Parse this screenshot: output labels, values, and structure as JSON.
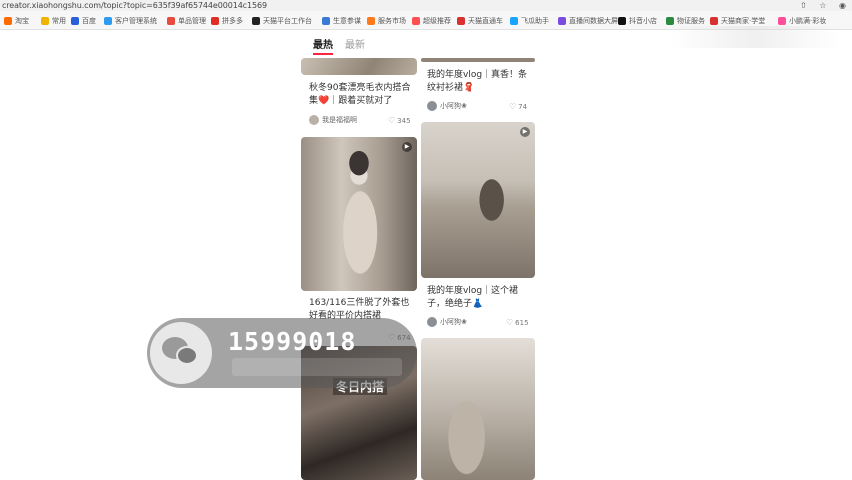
{
  "browser": {
    "url": "creator.xiaohongshu.com/topic?topic=635f39af65744e00014c1569",
    "bookmarks": [
      {
        "label": "淘宝",
        "color": "#ff6a00"
      },
      {
        "label": "常用",
        "color": "#f0b400"
      },
      {
        "label": "百度",
        "color": "#2b5fd9"
      },
      {
        "label": "客户管理系统",
        "color": "#2e9bf0"
      },
      {
        "label": "单品管理",
        "color": "#e84a3c"
      },
      {
        "label": "拼多多",
        "color": "#e02e24"
      },
      {
        "label": "天猫平台工作台",
        "color": "#222222"
      },
      {
        "label": "生意参谋",
        "color": "#3a7bd5"
      },
      {
        "label": "服务市场",
        "color": "#ff7a1a"
      },
      {
        "label": "超级推荐",
        "color": "#ff4f4f"
      },
      {
        "label": "天猫直通车",
        "color": "#d93030"
      },
      {
        "label": "飞瓜助手",
        "color": "#1aa3ff"
      },
      {
        "label": "直播间数据大屏",
        "color": "#7b4ce0"
      },
      {
        "label": "抖音小店",
        "color": "#111111"
      },
      {
        "label": "物证服务",
        "color": "#2b8a3e"
      },
      {
        "label": "天猫商家·学堂",
        "color": "#d93030"
      },
      {
        "label": "小鹏满·彩妆",
        "color": "#ff4f9a"
      }
    ]
  },
  "tabs": {
    "hot": "最热",
    "new": "最新"
  },
  "feed": {
    "left": [
      {
        "title": "秋冬90套漂亮毛衣内搭合集❤️｜跟着买就对了",
        "author": "我是福福啊",
        "likes": "345"
      },
      {
        "title": "163/116三件脱了外套也好看的平价内搭裙",
        "author": "",
        "likes": "674"
      },
      {
        "title": "冬日内搭",
        "author": "",
        "likes": ""
      }
    ],
    "right": [
      {
        "title": "我的年度vlog｜真香！条纹衬衫裙🧣",
        "author": "小阿狗❀",
        "likes": "74"
      },
      {
        "title": "我的年度vlog｜这个裙子，绝绝子👗",
        "author": "小阿狗❀",
        "likes": "615"
      },
      {
        "title": "",
        "author": "",
        "likes": ""
      }
    ]
  },
  "watermark": {
    "number": "15999018"
  },
  "icons": {
    "star": "star-icon",
    "share": "share-icon",
    "profile": "profile-icon",
    "play": "play-icon",
    "heart": "heart-icon",
    "wechat": "wechat-icon"
  }
}
